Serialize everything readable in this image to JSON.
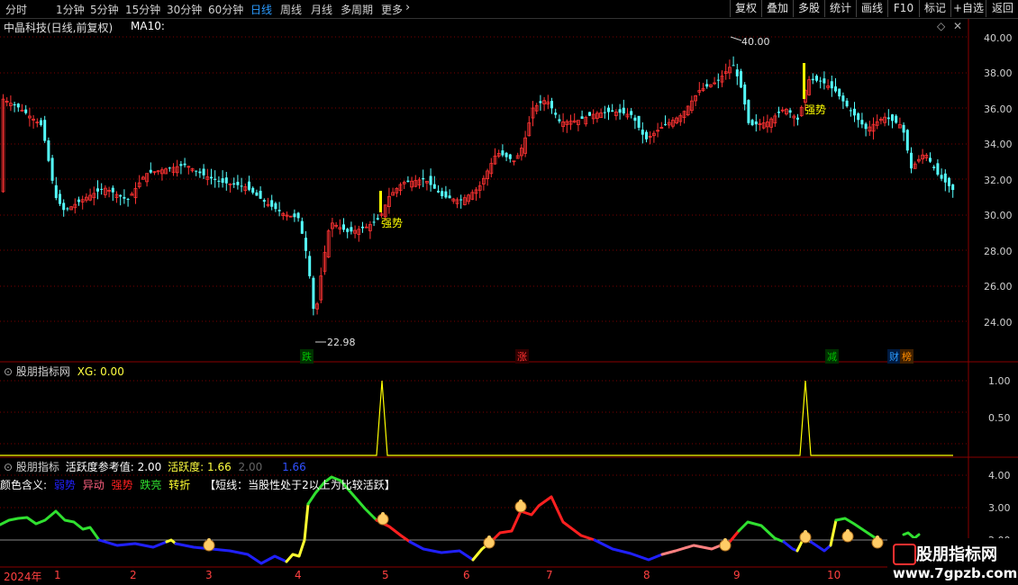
{
  "toolbar": {
    "periods": [
      "分时",
      "1分钟",
      "5分钟",
      "15分钟",
      "30分钟",
      "60分钟",
      "日线",
      "周线",
      "月线",
      "多周期",
      "更多"
    ],
    "active_period": "日线",
    "more_chevron": "›",
    "right_buttons": [
      "复权",
      "叠加",
      "多股",
      "统计",
      "画线",
      "F10",
      "标记",
      "+自选",
      "返回"
    ]
  },
  "main_chart": {
    "stock_title": "中晶科技(日线,前复权)",
    "ma_label": "MA10:",
    "high_label": "40.00",
    "low_label": "22.98",
    "signal_label": "强势",
    "event_tags": [
      {
        "text": "跌",
        "color": "#00c000"
      },
      {
        "text": "涨",
        "color": "#ff3030"
      },
      {
        "text": "减",
        "color": "#00c000"
      },
      {
        "text": "财",
        "color": "#2b9bff"
      },
      {
        "text": "榜",
        "color": "#ff8c00"
      }
    ],
    "y_axis_ticks": [
      "40.00",
      "38.00",
      "36.00",
      "34.00",
      "32.00",
      "30.00",
      "28.00",
      "26.00",
      "24.00"
    ]
  },
  "panel2": {
    "title": "股朋指标网",
    "value_text": "XG: 0.00",
    "y_axis_ticks": [
      "1.00",
      "0.50"
    ]
  },
  "panel3": {
    "title": "股朋指标",
    "ref_text": "活跃度参考值: 2.00",
    "active_text": "活跃度: 1.66",
    "grey_value": "2.00",
    "blue_value": "1.66",
    "legend_label": "颜色含义:",
    "legend_items": [
      {
        "text": "弱势",
        "color": "#2020ff"
      },
      {
        "text": "异动",
        "color": "#ff6080"
      },
      {
        "text": "强势",
        "color": "#ff2020"
      },
      {
        "text": "跌亮",
        "color": "#30e030"
      },
      {
        "text": "转折",
        "color": "#ffff30"
      }
    ],
    "note": "【短线：当股性处于2以上为比较活跃】",
    "y_axis_ticks": [
      "4.00",
      "3.00",
      "2.00"
    ]
  },
  "x_axis": {
    "labels": [
      "2024年",
      "1",
      "2",
      "3",
      "4",
      "5",
      "6",
      "7",
      "8",
      "9",
      "10"
    ]
  },
  "watermark": {
    "title": "股朋指标网",
    "url": "www.7gpzb.com"
  },
  "colors": {
    "up": "#ff3232",
    "down": "#54ffff",
    "grid": "#7a0000",
    "signal": "#ffff00"
  }
}
